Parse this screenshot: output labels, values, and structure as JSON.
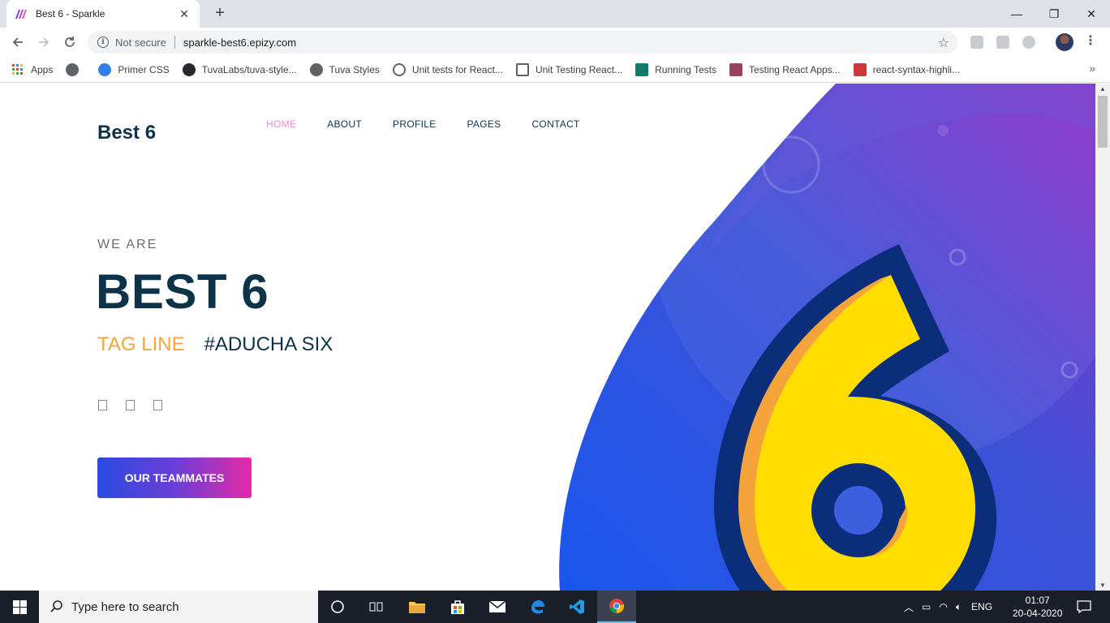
{
  "browser": {
    "tab_title": "Best 6 - Sparkle",
    "tab_close": "✕",
    "new_tab": "+",
    "window_minimize": "—",
    "window_restore": "❐",
    "window_close": "✕",
    "security_label": "Not secure",
    "url": "sparkle-best6.epizy.com",
    "bookmarks": [
      {
        "label": "Apps",
        "icon": "apps-grid-icon",
        "color": "#4285f4"
      },
      {
        "label": "",
        "icon": "globe-icon",
        "color": "#5f6368"
      },
      {
        "label": "Primer CSS",
        "icon": "primer-icon",
        "color": "#2f80ed"
      },
      {
        "label": "TuvaLabs/tuva-style...",
        "icon": "github-icon",
        "color": "#24292e"
      },
      {
        "label": "Tuva Styles",
        "icon": "globe-icon",
        "color": "#5f6368"
      },
      {
        "label": "Unit tests for React...",
        "icon": "web-icon",
        "color": "#5f6368"
      },
      {
        "label": "Unit Testing React...",
        "icon": "slides-icon",
        "color": "#5f6368"
      },
      {
        "label": "Running Tests",
        "icon": "react-icon",
        "color": "#0f7b6c"
      },
      {
        "label": "Testing React Apps...",
        "icon": "jest-icon",
        "color": "#99425b"
      },
      {
        "label": "react-syntax-highli...",
        "icon": "npm-icon",
        "color": "#cb3837"
      }
    ],
    "bookmarks_more": "»"
  },
  "site": {
    "brand": "Best 6",
    "nav": [
      "HOME",
      "ABOUT",
      "PROFILE",
      "PAGES",
      "CONTACT"
    ],
    "active_nav": "HOME",
    "hero": {
      "eyebrow": "WE ARE",
      "title": "BEST 6",
      "tagline": "TAG LINE",
      "hashtag": "#ADUCHA SIX",
      "cta": "OUR TEAMMATES"
    },
    "colors": {
      "primary_text": "#0d3349",
      "accent_orange": "#f4a43b",
      "accent_pink": "#e88ed2",
      "blob_blue": "#1e52e6",
      "blob_purple": "#8a33c8",
      "six_yellow": "#ffdd00",
      "six_outline": "#0a2e7a"
    }
  },
  "taskbar": {
    "search_placeholder": "Type here to search",
    "language": "ENG",
    "time": "01:07",
    "date": "20-04-2020"
  }
}
